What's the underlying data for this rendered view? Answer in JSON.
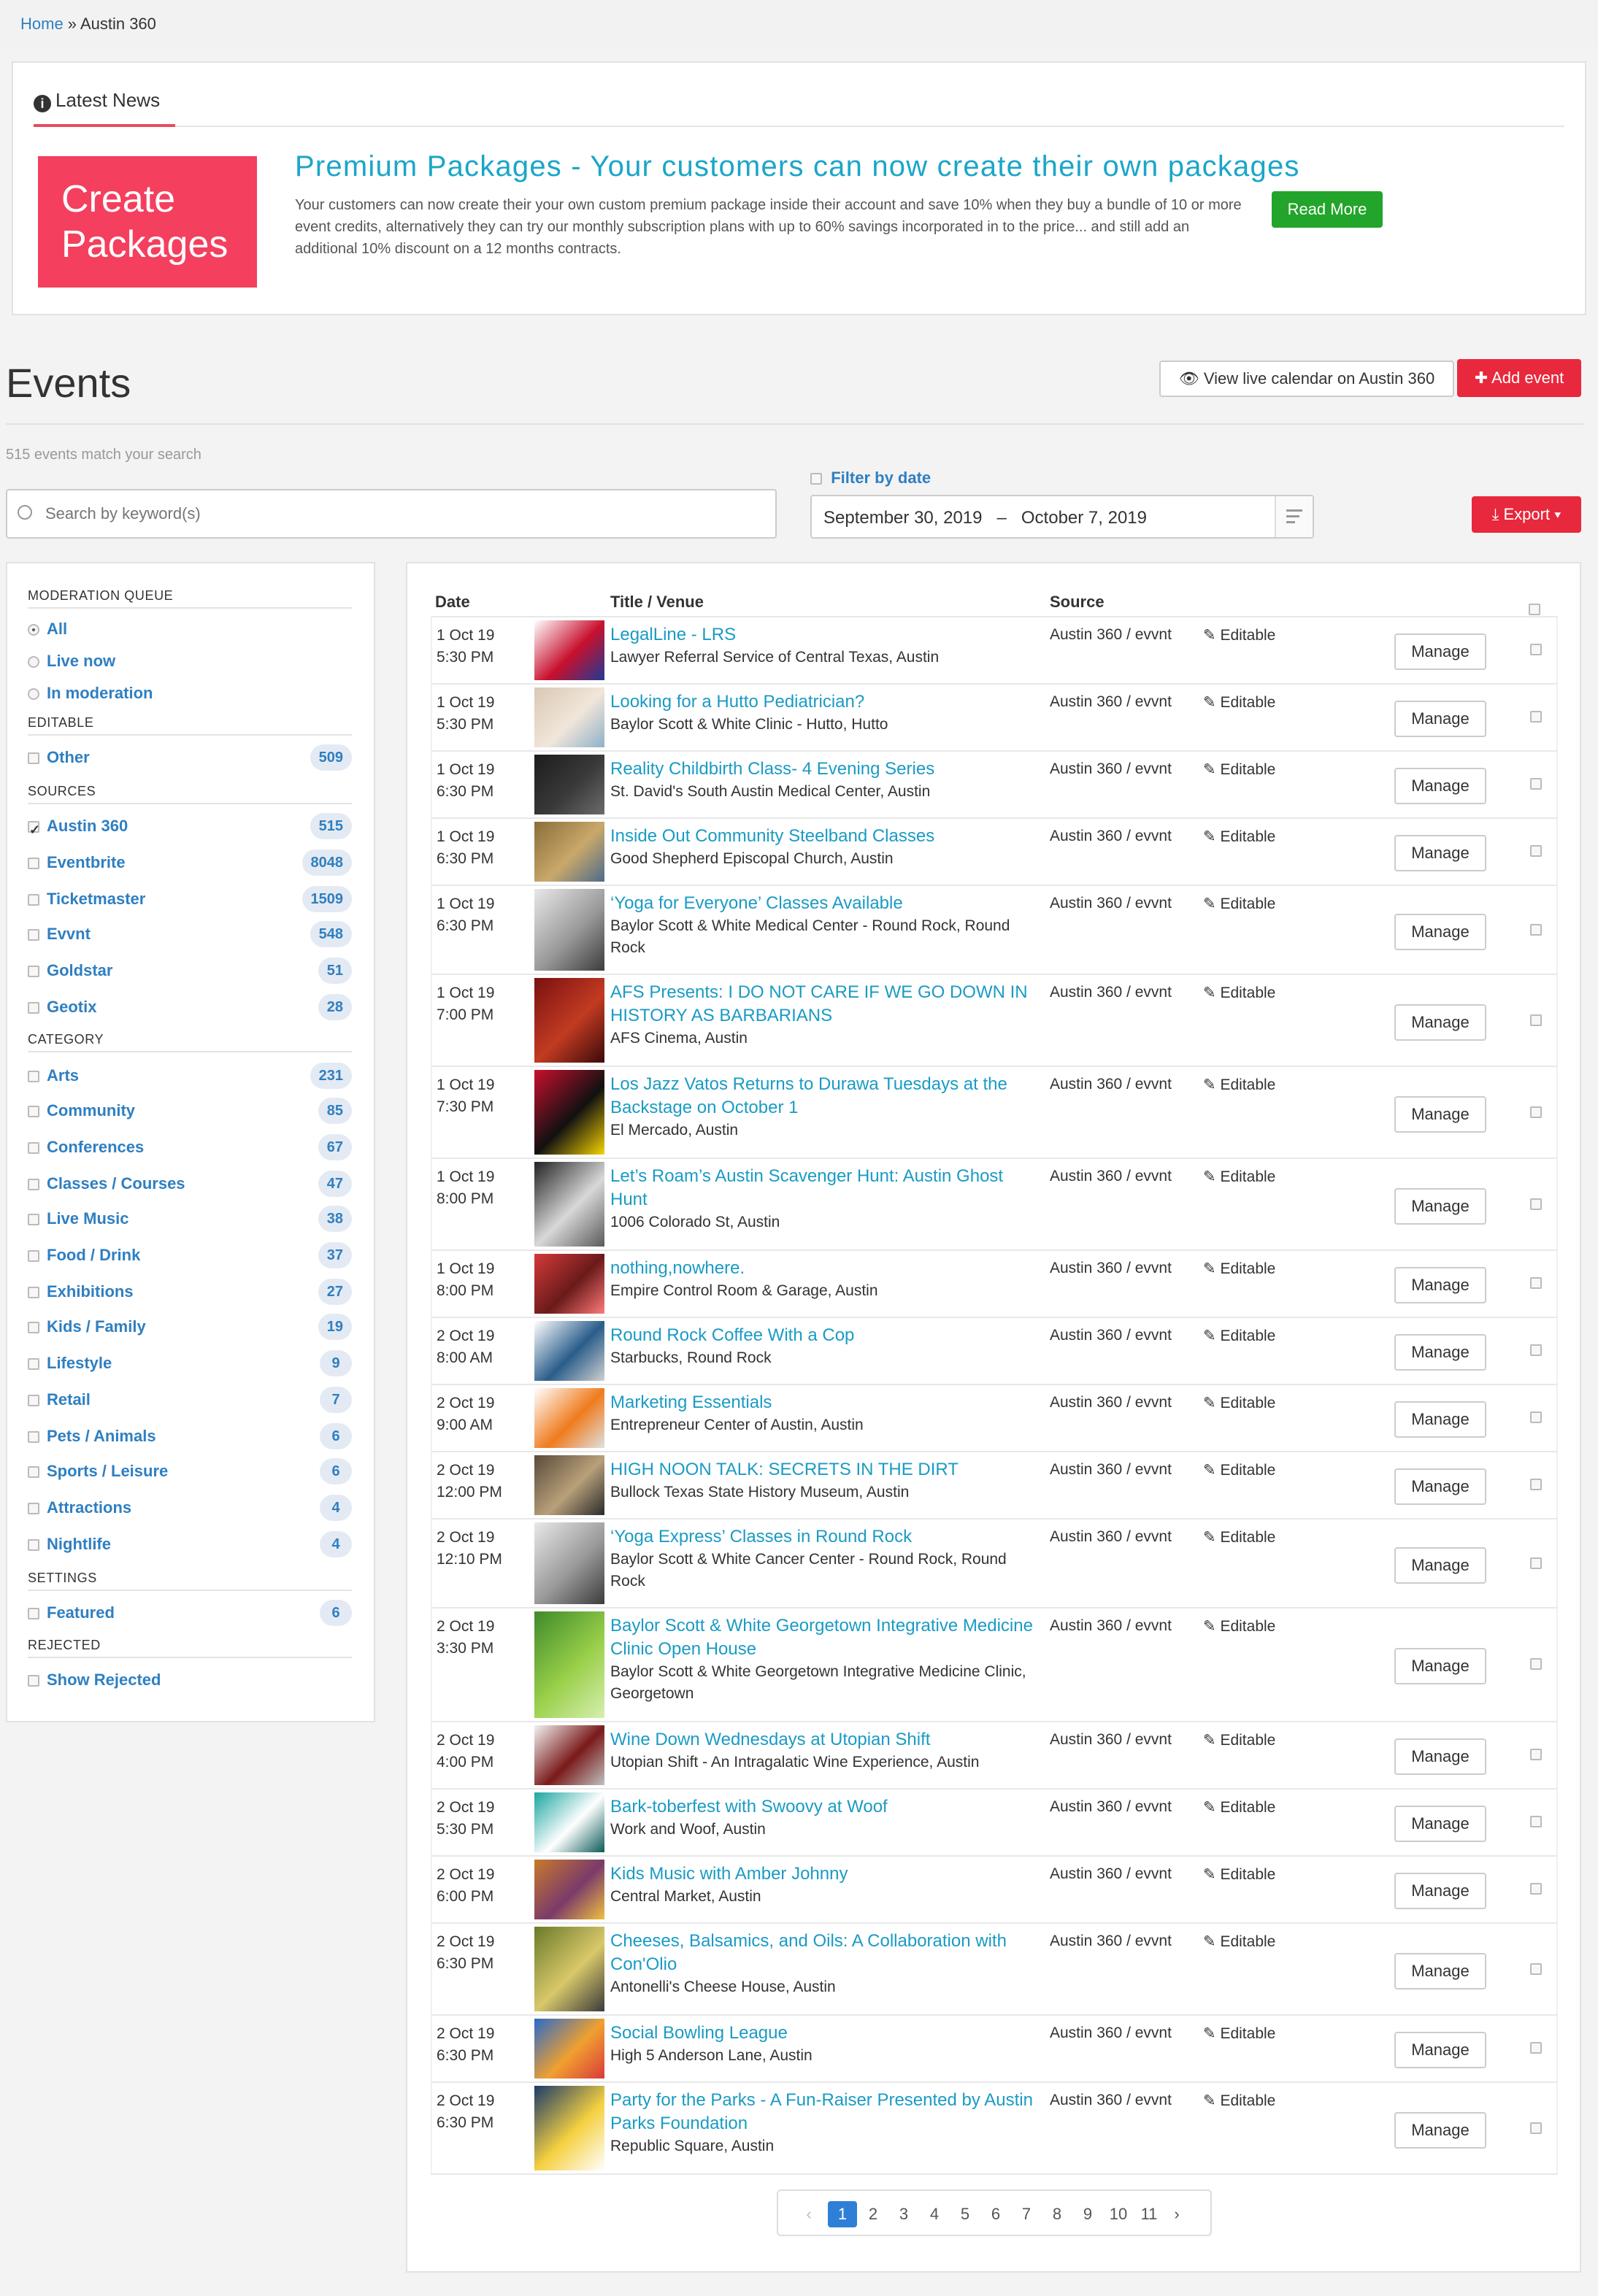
{
  "breadcrumb": {
    "home": "Home",
    "sep": " » ",
    "current": "Austin 360"
  },
  "news": {
    "heading": "Latest News",
    "tile_line1": "Create",
    "tile_line2": "Packages",
    "title": "Premium Packages - Your customers can now create their own packages",
    "body": "Your customers can now create their your own custom premium package inside their account and save 10% when they buy a bundle of 10 or more event credits, alternatively they can try our monthly subscription plans with up to 60% savings incorporated in to the price... and still add an additional 10% discount on a 12 months contracts.",
    "read_more": "Read More"
  },
  "events": {
    "title": "Events",
    "view_calendar": "View live calendar on Austin 360",
    "add_event": "Add event",
    "count_text": "515 events match your search",
    "search_placeholder": "Search by keyword(s)",
    "filter_by_date": "Filter by date",
    "date_from": "September 30, 2019",
    "date_dash": "–",
    "date_to": "October 7, 2019",
    "export": "Export"
  },
  "sidebar": {
    "moderation_heading": "MODERATION QUEUE",
    "moderation": [
      {
        "label": "All",
        "selected": true
      },
      {
        "label": "Live now",
        "selected": false
      },
      {
        "label": "In moderation",
        "selected": false
      }
    ],
    "editable_heading": "EDITABLE",
    "editable": [
      {
        "label": "Other",
        "count": "509"
      }
    ],
    "sources_heading": "SOURCES",
    "sources": [
      {
        "label": "Austin 360",
        "count": "515",
        "checked": true
      },
      {
        "label": "Eventbrite",
        "count": "8048"
      },
      {
        "label": "Ticketmaster",
        "count": "1509"
      },
      {
        "label": "Evvnt",
        "count": "548"
      },
      {
        "label": "Goldstar",
        "count": "51"
      },
      {
        "label": "Geotix",
        "count": "28"
      }
    ],
    "category_heading": "CATEGORY",
    "categories": [
      {
        "label": "Arts",
        "count": "231"
      },
      {
        "label": "Community",
        "count": "85"
      },
      {
        "label": "Conferences",
        "count": "67"
      },
      {
        "label": "Classes / Courses",
        "count": "47"
      },
      {
        "label": "Live Music",
        "count": "38"
      },
      {
        "label": "Food / Drink",
        "count": "37"
      },
      {
        "label": "Exhibitions",
        "count": "27"
      },
      {
        "label": "Kids / Family",
        "count": "19"
      },
      {
        "label": "Lifestyle",
        "count": "9"
      },
      {
        "label": "Retail",
        "count": "7"
      },
      {
        "label": "Pets / Animals",
        "count": "6"
      },
      {
        "label": "Sports / Leisure",
        "count": "6"
      },
      {
        "label": "Attractions",
        "count": "4"
      },
      {
        "label": "Nightlife",
        "count": "4"
      }
    ],
    "settings_heading": "SETTINGS",
    "settings": [
      {
        "label": "Featured",
        "count": "6"
      }
    ],
    "rejected_heading": "REJECTED",
    "rejected": [
      {
        "label": "Show Rejected"
      }
    ]
  },
  "table": {
    "col_date": "Date",
    "col_title": "Title / Venue",
    "col_source": "Source",
    "editable_label": "Editable",
    "manage_label": "Manage",
    "rows": [
      {
        "date": "1 Oct 19",
        "time": "5:30 PM",
        "title": "LegalLine - LRS",
        "venue": "Lawyer Referral Service of Central Texas, Austin",
        "source": "Austin 360 / evvnt",
        "thumb_colors": [
          "#ffffff",
          "#c8102e",
          "#1f3a93"
        ]
      },
      {
        "date": "1 Oct 19",
        "time": "5:30 PM",
        "title": "Looking for a Hutto Pediatrician?",
        "venue": "Baylor Scott & White Clinic - Hutto, Hutto",
        "source": "Austin 360 / evvnt",
        "thumb_colors": [
          "#d9c8b4",
          "#f1e6da",
          "#8fb0c8"
        ]
      },
      {
        "date": "1 Oct 19",
        "time": "6:30 PM",
        "title": "Reality Childbirth Class- 4 Evening Series",
        "venue": "St. David's South Austin Medical Center, Austin",
        "source": "Austin 360 / evvnt",
        "thumb_colors": [
          "#1c1c1c",
          "#3a3a3a",
          "#6b6b6b"
        ]
      },
      {
        "date": "1 Oct 19",
        "time": "6:30 PM",
        "title": "Inside Out Community Steelband Classes",
        "venue": "Good Shepherd Episcopal Church, Austin",
        "source": "Austin 360 / evvnt",
        "thumb_colors": [
          "#8a6d3b",
          "#c9a86a",
          "#4d6b8a"
        ]
      },
      {
        "date": "1 Oct 19",
        "time": "6:30 PM",
        "title": "‘Yoga for Everyone’ Classes Available",
        "venue": "Baylor Scott & White Medical Center - Round Rock, Round Rock",
        "source": "Austin 360 / evvnt",
        "thumb_colors": [
          "#e8e8e8",
          "#9a9a9a",
          "#3c3c3c"
        ]
      },
      {
        "date": "1 Oct 19",
        "time": "7:00 PM",
        "title": "AFS Presents: I DO NOT CARE IF WE GO DOWN IN HISTORY AS BARBARIANS",
        "venue": "AFS Cinema, Austin",
        "source": "Austin 360 / evvnt",
        "thumb_colors": [
          "#7a1010",
          "#c23b22",
          "#3b0a0a"
        ]
      },
      {
        "date": "1 Oct 19",
        "time": "7:30 PM",
        "title": "Los Jazz Vatos Returns to Durawa Tuesdays at the Backstage on October 1",
        "venue": "El Mercado, Austin",
        "source": "Austin 360 / evvnt",
        "thumb_colors": [
          "#c8102e",
          "#111111",
          "#f5d400"
        ]
      },
      {
        "date": "1 Oct 19",
        "time": "8:00 PM",
        "title": "Let’s Roam’s Austin Scavenger Hunt: Austin Ghost Hunt",
        "venue": "1006 Colorado St, Austin",
        "source": "Austin 360 / evvnt",
        "thumb_colors": [
          "#222222",
          "#d8d8d8",
          "#5a5a5a"
        ]
      },
      {
        "date": "1 Oct 19",
        "time": "8:00 PM",
        "title": "nothing,nowhere.",
        "venue": "Empire Control Room & Garage, Austin",
        "source": "Austin 360 / evvnt",
        "thumb_colors": [
          "#d43a3a",
          "#6a1a1a",
          "#ff7a7a"
        ]
      },
      {
        "date": "2 Oct 19",
        "time": "8:00 AM",
        "title": "Round Rock Coffee With a Cop",
        "venue": "Starbucks, Round Rock",
        "source": "Austin 360 / evvnt",
        "thumb_colors": [
          "#ffffff",
          "#2a5d8a",
          "#d0d0d0"
        ]
      },
      {
        "date": "2 Oct 19",
        "time": "9:00 AM",
        "title": "Marketing Essentials",
        "venue": "Entrepreneur Center of Austin, Austin",
        "source": "Austin 360 / evvnt",
        "thumb_colors": [
          "#ffffff",
          "#f07b1d",
          "#e0e0e0"
        ]
      },
      {
        "date": "2 Oct 19",
        "time": "12:00 PM",
        "title": "HIGH NOON TALK: SECRETS IN THE DIRT",
        "venue": "Bullock Texas State History Museum, Austin",
        "source": "Austin 360 / evvnt",
        "thumb_colors": [
          "#5a4a3a",
          "#b8a07a",
          "#2a2a2a"
        ]
      },
      {
        "date": "2 Oct 19",
        "time": "12:10 PM",
        "title": "‘Yoga Express’ Classes in Round Rock",
        "venue": "Baylor Scott & White Cancer Center - Round Rock, Round Rock",
        "source": "Austin 360 / evvnt",
        "thumb_colors": [
          "#e8e8e8",
          "#9a9a9a",
          "#3c3c3c"
        ]
      },
      {
        "date": "2 Oct 19",
        "time": "3:30 PM",
        "title": "Baylor Scott & White Georgetown Integrative Medicine Clinic Open House",
        "venue": "Baylor Scott & White Georgetown Integrative Medicine Clinic, Georgetown",
        "source": "Austin 360 / evvnt",
        "thumb_colors": [
          "#3f8a2a",
          "#9ad04a",
          "#d6efb0"
        ]
      },
      {
        "date": "2 Oct 19",
        "time": "4:00 PM",
        "title": "Wine Down Wednesdays at Utopian Shift",
        "venue": "Utopian Shift - An Intragalatic Wine Experience, Austin",
        "source": "Austin 360 / evvnt",
        "thumb_colors": [
          "#f2f2f2",
          "#7a1a1a",
          "#c0c0c0"
        ]
      },
      {
        "date": "2 Oct 19",
        "time": "5:30 PM",
        "title": "Bark-toberfest with Swoovy at Woof",
        "venue": "Work and Woof, Austin",
        "source": "Austin 360 / evvnt",
        "thumb_colors": [
          "#1aa6a0",
          "#ffffff",
          "#0a5a58"
        ]
      },
      {
        "date": "2 Oct 19",
        "time": "6:00 PM",
        "title": "Kids Music with Amber Johnny",
        "venue": "Central Market, Austin",
        "source": "Austin 360 / evvnt",
        "thumb_colors": [
          "#c87a2a",
          "#7a3a6a",
          "#f0c040"
        ]
      },
      {
        "date": "2 Oct 19",
        "time": "6:30 PM",
        "title": "Cheeses, Balsamics, and Oils: A Collaboration with Con'Olio",
        "venue": "Antonelli's Cheese House, Austin",
        "source": "Austin 360 / evvnt",
        "thumb_colors": [
          "#6a7a2a",
          "#d8c86a",
          "#3a3a3a"
        ]
      },
      {
        "date": "2 Oct 19",
        "time": "6:30 PM",
        "title": "Social Bowling League",
        "venue": "High 5 Anderson Lane, Austin",
        "source": "Austin 360 / evvnt",
        "thumb_colors": [
          "#2a6ac8",
          "#f0a030",
          "#d83a3a"
        ]
      },
      {
        "date": "2 Oct 19",
        "time": "6:30 PM",
        "title": "Party for the Parks - A Fun-Raiser Presented by Austin Parks Foundation",
        "venue": "Republic Square, Austin",
        "source": "Austin 360 / evvnt",
        "thumb_colors": [
          "#1a3a6a",
          "#f5d040",
          "#ffffff"
        ]
      }
    ]
  },
  "pagination": {
    "prev": "‹",
    "pages": [
      "1",
      "2",
      "3",
      "4",
      "5",
      "6",
      "7",
      "8",
      "9",
      "10",
      "11"
    ],
    "active": "1",
    "next": "›"
  },
  "colors": {
    "link": "#2f7fc1",
    "title_link": "#1a9bc4",
    "danger": "#e8283c",
    "success": "#22a52a",
    "tile": "#f43f5e"
  }
}
